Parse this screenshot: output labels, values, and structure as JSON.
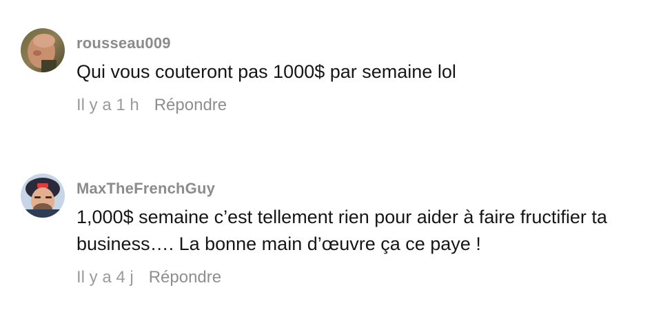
{
  "comments": [
    {
      "username": "rousseau009",
      "text": "Qui vous couteront pas 1000$ par semaine lol",
      "timestamp": "Il y a 1 h",
      "reply_label": "Répondre",
      "avatar_icon": "user-avatar-photo"
    },
    {
      "username": "MaxTheFrenchGuy",
      "text": "1,000$ semaine c’est tellement rien pour aider à faire fructifier ta business…. La bonne main d’œuvre ça ce paye !",
      "timestamp": "Il y a 4 j",
      "reply_label": "Répondre",
      "avatar_icon": "user-avatar-photo"
    }
  ],
  "colors": {
    "username": "#8b8b8b",
    "text": "#161616",
    "meta": "#9a9a9a",
    "background": "#ffffff"
  }
}
